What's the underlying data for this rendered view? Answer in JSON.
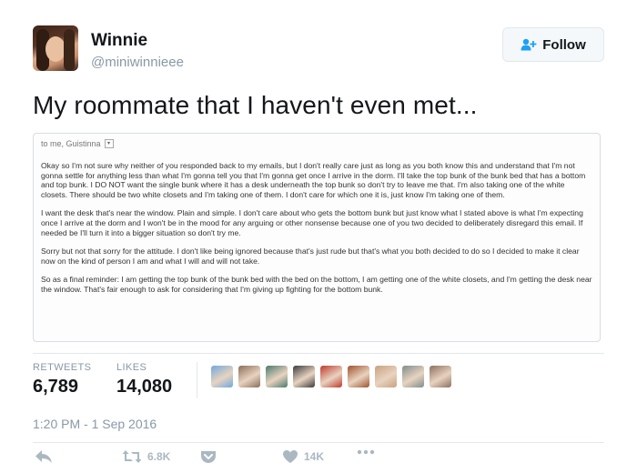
{
  "profile": {
    "display_name": "Winnie",
    "handle": "@miniwinnieee"
  },
  "follow_label": "Follow",
  "tweet": {
    "text": "My roommate that I haven't even met..."
  },
  "email": {
    "to_line": "to me, Guistinna",
    "paragraphs": [
      "Okay so I'm not sure why neither of you responded back to my emails, but I don't really care just as long as you both know this and understand that I'm not gonna settle for anything less than what I'm gonna tell you that I'm gonna get once I arrive in the dorm. I'll take the top bunk of the bunk bed that has a bottom and top bunk. I DO NOT want the single bunk where it has a desk underneath the top bunk so don't try to leave me that. I'm also taking one of the white closets. There should be two white closets and I'm taking one of them. I don't care for which one it is, just know I'm taking one of them.",
      "I want the desk that's near the window. Plain and simple. I don't care about who gets the bottom bunk but just know what I stated above is what I'm expecting once I arrive at the dorm and I won't be in the mood for any arguing or other nonsense because one of you two decided to deliberately disregard this email. If needed be I'll turn it into a bigger situation so don't try me.",
      "Sorry but not that sorry for the attitude. I don't like being ignored because that's just rude but that's what you both decided to do so I decided to make it clear now on the kind of person I am and what I will and will not take.",
      "So as a final reminder: I am getting the top bunk of the bunk bed with the bed on the bottom, I am getting one of the white closets, and I'm getting the desk near the window. That's fair enough to ask for considering that I'm giving up fighting for the bottom bunk."
    ]
  },
  "stats": {
    "retweets_label": "RETWEETS",
    "retweets": "6,789",
    "likes_label": "LIKES",
    "likes": "14,080"
  },
  "likers": [
    {
      "color": "#6fa8dc"
    },
    {
      "color": "#8a6d5a"
    },
    {
      "color": "#4a7a6a"
    },
    {
      "color": "#3b3b3b"
    },
    {
      "color": "#c0392b"
    },
    {
      "color": "#a0522d"
    },
    {
      "color": "#c9a27e"
    },
    {
      "color": "#7f8c8d"
    },
    {
      "color": "#8e6f5e"
    }
  ],
  "timestamp": "1:20 PM - 1 Sep 2016",
  "actions": {
    "retweet_count": "6.8K",
    "like_count": "14K"
  },
  "icons": {
    "follow": "add-user-icon",
    "reply": "reply-icon",
    "retweet": "retweet-icon",
    "pocket": "pocket-icon",
    "like": "heart-icon",
    "more": "more-dots-icon"
  }
}
